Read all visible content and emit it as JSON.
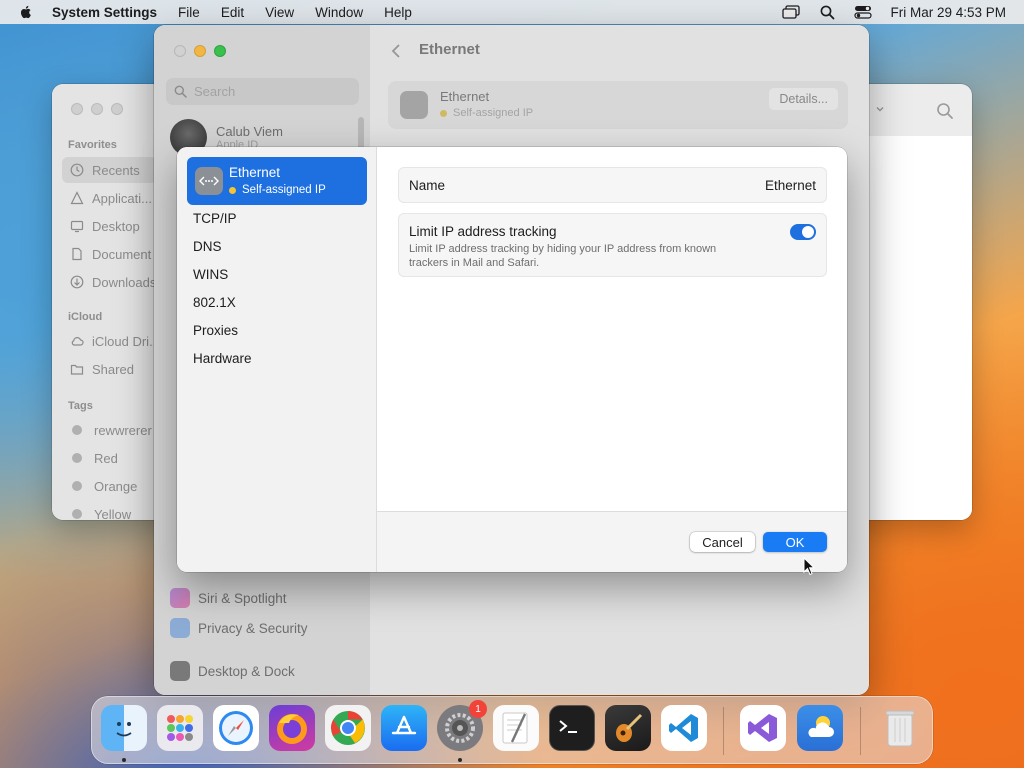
{
  "menubar": {
    "app_name": "System Settings",
    "menus": [
      "File",
      "Edit",
      "View",
      "Window",
      "Help"
    ],
    "clock": "Fri Mar 29  4:53 PM",
    "icons": [
      "apple-icon",
      "screen-mirroring-icon",
      "spotlight-search-icon",
      "control-center-icon"
    ]
  },
  "finder": {
    "favorites_title": "Favorites",
    "favorites": [
      "Recents",
      "Applicati...",
      "Desktop",
      "Document",
      "Downloads"
    ],
    "icloud_title": "iCloud",
    "icloud": [
      "iCloud Dri...",
      "Shared"
    ],
    "tags_title": "Tags",
    "tags": [
      "rewwrerer",
      "Red",
      "Orange",
      "Yellow"
    ]
  },
  "settings": {
    "search_placeholder": "Search",
    "account_name": "Calub Viem",
    "account_sub": "Apple ID",
    "nav_items": [
      "Siri & Spotlight",
      "Privacy & Security",
      "Desktop & Dock"
    ],
    "pane_title": "Ethernet",
    "ethernet_row": {
      "name": "Ethernet",
      "status": "Self-assigned IP",
      "details_label": "Details..."
    }
  },
  "sheet": {
    "selected": {
      "name": "Ethernet",
      "status": "Self-assigned IP"
    },
    "nav": [
      "TCP/IP",
      "DNS",
      "WINS",
      "802.1X",
      "Proxies",
      "Hardware"
    ],
    "name_label": "Name",
    "name_value": "Ethernet",
    "tracking_title": "Limit IP address tracking",
    "tracking_desc": "Limit IP address tracking by hiding your IP address from known trackers in Mail and Safari.",
    "tracking_enabled": true,
    "cancel_label": "Cancel",
    "ok_label": "OK",
    "accent_color": "#1e6fe0"
  },
  "dock": {
    "apps": [
      "Finder",
      "Launchpad",
      "Safari",
      "Firefox",
      "Chrome",
      "App Store",
      "System Settings",
      "TextEdit",
      "Terminal",
      "GarageBand",
      "Visual Studio Code",
      "Visual Studio",
      "Weather",
      "Trash"
    ],
    "system_settings_badge": "1"
  }
}
